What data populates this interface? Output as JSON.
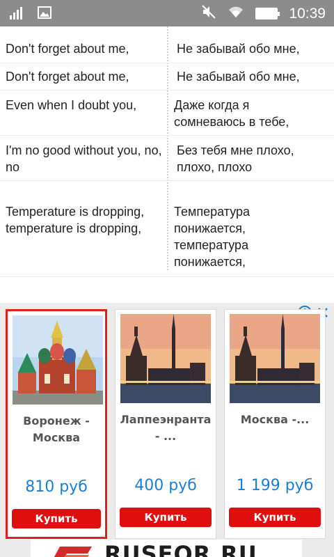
{
  "status_bar": {
    "time": "10:39",
    "icons": [
      "signal-icon",
      "image-icon",
      "mute-icon",
      "wifi-icon",
      "battery-icon"
    ]
  },
  "lyrics": [
    {
      "en": "Don't forget about me,",
      "ru": "Не забывай обо мне,"
    },
    {
      "en": "Don't forget about me,",
      "ru": "Не забывай обо мне,"
    },
    {
      "en": "Even when I doubt you,",
      "ru": "Даже когда я сомневаюсь в тебе,"
    },
    {
      "en": "I'm no good without you, no, no",
      "ru": "Без тебя мне плохо, плохо, плохо"
    },
    {
      "en": "Temperature is dropping, temperature is dropping,",
      "ru": "Температура понижается, температура понижается,"
    }
  ],
  "ad": {
    "icons": [
      "info-icon",
      "close-icon"
    ],
    "cards": [
      {
        "title": "Воронеж - Москва",
        "price": "810 руб",
        "button": "Купить"
      },
      {
        "title": "Лаппеэнранта - ...",
        "price": "400 руб",
        "button": "Купить"
      },
      {
        "title": "Москва -...",
        "price": "1 199 руб",
        "button": "Купить"
      }
    ],
    "brand": "RUSFOR.RU"
  },
  "colors": {
    "status_bar": "#8c8c8c",
    "price": "#1a7fd4",
    "buy_button": "#e00f0f",
    "selected_border": "#e02020"
  }
}
